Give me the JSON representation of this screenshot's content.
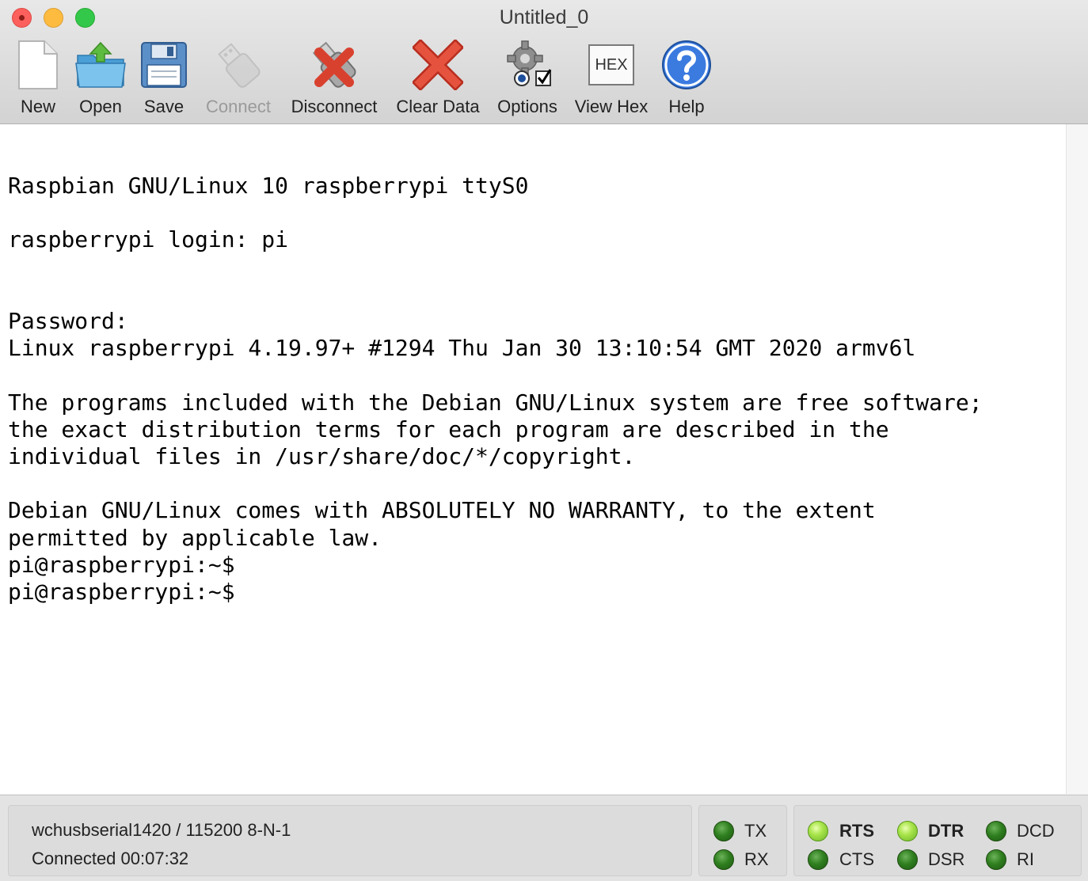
{
  "window": {
    "title": "Untitled_0"
  },
  "toolbar": {
    "new_label": "New",
    "open_label": "Open",
    "save_label": "Save",
    "connect_label": "Connect",
    "disconnect_label": "Disconnect",
    "clear_label": "Clear Data",
    "options_label": "Options",
    "viewhex_label": "View Hex",
    "viewhex_icon_text": "HEX",
    "help_label": "Help"
  },
  "terminal": {
    "lines": [
      "Raspbian GNU/Linux 10 raspberrypi ttyS0",
      "",
      "raspberrypi login: pi",
      "",
      "",
      "Password:",
      "Linux raspberrypi 4.19.97+ #1294 Thu Jan 30 13:10:54 GMT 2020 armv6l",
      "",
      "The programs included with the Debian GNU/Linux system are free software;",
      "the exact distribution terms for each program are described in the",
      "individual files in /usr/share/doc/*/copyright.",
      "",
      "Debian GNU/Linux comes with ABSOLUTELY NO WARRANTY, to the extent",
      "permitted by applicable law.",
      "pi@raspberrypi:~$",
      "pi@raspberrypi:~$"
    ]
  },
  "status": {
    "port": "wchusbserial1420 / 115200 8-N-1",
    "connection": "Connected 00:07:32",
    "signals": {
      "tx": {
        "label": "TX",
        "active": false
      },
      "rx": {
        "label": "RX",
        "active": false
      },
      "rts": {
        "label": "RTS",
        "active": true
      },
      "cts": {
        "label": "CTS",
        "active": false
      },
      "dtr": {
        "label": "DTR",
        "active": true
      },
      "dsr": {
        "label": "DSR",
        "active": false
      },
      "dcd": {
        "label": "DCD",
        "active": false
      },
      "ri": {
        "label": "RI",
        "active": false
      }
    }
  },
  "icons": {
    "close_color": "#fc605c",
    "minimize_color": "#fdbc40",
    "zoom_color": "#34c84a",
    "led_on_color": "#a8e44a",
    "led_off_color": "#2f7f1f"
  }
}
